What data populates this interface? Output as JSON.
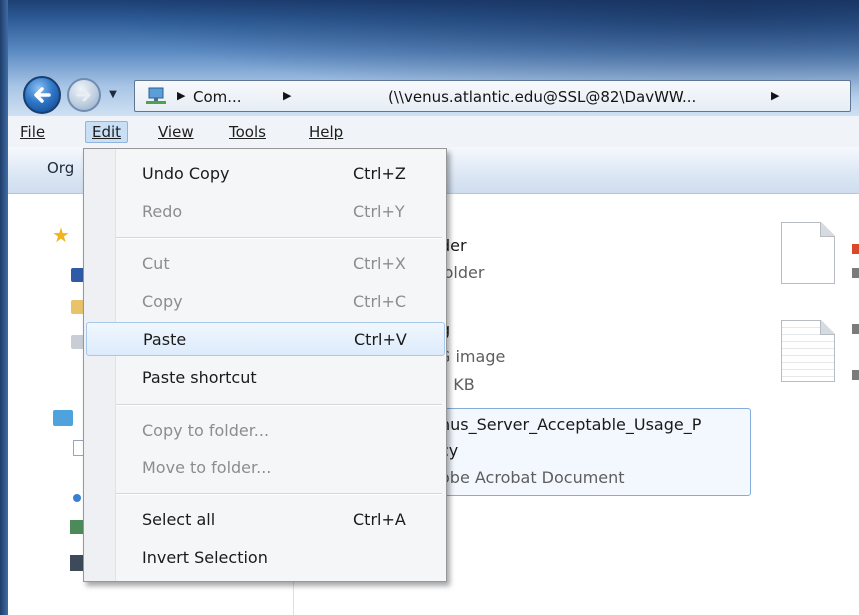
{
  "window": {
    "address": {
      "crumb_computer": "Com...",
      "crumb_path": "(\\\\venus.atlantic.edu@SSL@82\\DavWW...",
      "arrow": "▶"
    },
    "recent_pages_glyph": "▼"
  },
  "menubar": {
    "file": "File",
    "edit": "Edit",
    "view": "View",
    "tools": "Tools",
    "help": "Help"
  },
  "toolbar": {
    "organize_label": "Org"
  },
  "edit_menu": {
    "items": [
      {
        "label": "Undo Copy",
        "shortcut": "Ctrl+Z",
        "enabled": true
      },
      {
        "label": "Redo",
        "shortcut": "Ctrl+Y",
        "enabled": false
      },
      {
        "label": "Cut",
        "shortcut": "Ctrl+X",
        "enabled": false
      },
      {
        "label": "Copy",
        "shortcut": "Ctrl+C",
        "enabled": false
      },
      {
        "label": "Paste",
        "shortcut": "Ctrl+V",
        "enabled": true,
        "highlighted": true
      },
      {
        "label": "Paste shortcut",
        "shortcut": "",
        "enabled": true
      },
      {
        "label": "Copy to folder...",
        "shortcut": "",
        "enabled": false
      },
      {
        "label": "Move to folder...",
        "shortcut": "",
        "enabled": false
      },
      {
        "label": "Select all",
        "shortcut": "Ctrl+A",
        "enabled": true
      },
      {
        "label": "Invert Selection",
        "shortcut": "",
        "enabled": true
      }
    ]
  },
  "files": [
    {
      "name": "der",
      "type": "folder"
    },
    {
      "name": "g",
      "type": "G image",
      "size": "5 KB"
    },
    {
      "name": "nus_Server_Acceptable_Usage_P",
      "name_line2": "cy",
      "type": "obe Acrobat Document",
      "selected": true
    }
  ],
  "nav_pane": {
    "favorites_glyph": "★"
  },
  "colors": {
    "accent": "#2f78c8",
    "menu_highlight": "#dcebfc",
    "disabled_text": "#8d8d8d"
  },
  "icons": [
    "back-icon",
    "forward-icon",
    "network-computer-icon",
    "favorites-star-icon",
    "document-icon",
    "pdf-document-icon"
  ]
}
